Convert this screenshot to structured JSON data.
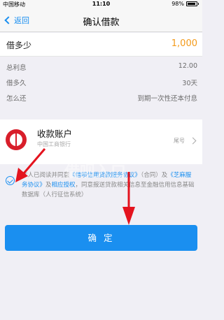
{
  "status_bar": {
    "carrier": "中国移动",
    "wifi_icon": "wifi-icon",
    "time": "11:10",
    "battery": "98%"
  },
  "nav": {
    "back_label": "返回",
    "title": "确认借款"
  },
  "amount": {
    "label": "借多少",
    "value": "1,000"
  },
  "info": [
    {
      "label": "总利息",
      "value": "12.00"
    },
    {
      "label": "借多久",
      "value": "30天"
    },
    {
      "label": "怎么还",
      "value": "到期一次性还本付息"
    }
  ],
  "account": {
    "title": "收款账户",
    "subtitle": "中国工商银行",
    "number": "尾号"
  },
  "agreement": {
    "prefix": "本人已阅读并同意",
    "link1": "《借呗信用贷款服务协议》",
    "mid": "（合同）及",
    "link2": "《芝麻服务协议》",
    "and": "及",
    "link3": "相应授权",
    "suffix": "，同意报送贷款相关信息至金融信用信息基础数据库（人行征信系统）"
  },
  "button": {
    "label": "确 定"
  },
  "watermark": {
    "line1": "支付宝",
    "line2": "借呗入口"
  },
  "colors": {
    "accent": "#1a8ff0",
    "amount": "#f39a1a",
    "bank": "#d81e2a",
    "arrow": "#e4131e"
  }
}
